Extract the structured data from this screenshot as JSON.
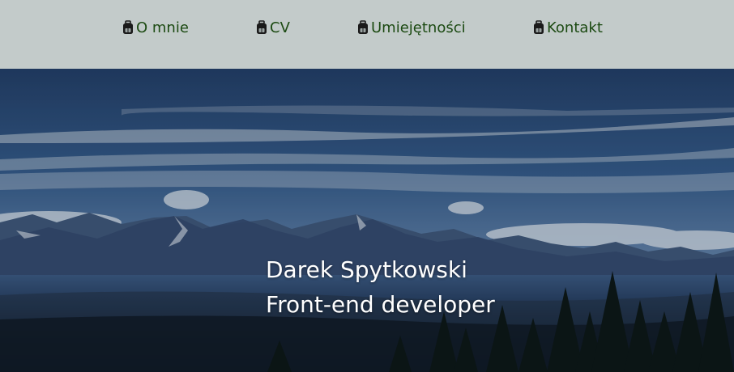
{
  "nav": {
    "items": [
      {
        "label": "O mnie",
        "icon": "backpack-icon"
      },
      {
        "label": "CV",
        "icon": "backpack-icon"
      },
      {
        "label": "Umiejętności",
        "icon": "backpack-icon"
      },
      {
        "label": "Kontakt",
        "icon": "backpack-icon"
      }
    ],
    "background": "#c3cbca",
    "text_color": "#1c4a12"
  },
  "hero": {
    "name": "Darek Spytkowski",
    "role": "Front-end developer",
    "text_color": "#ffffff"
  }
}
